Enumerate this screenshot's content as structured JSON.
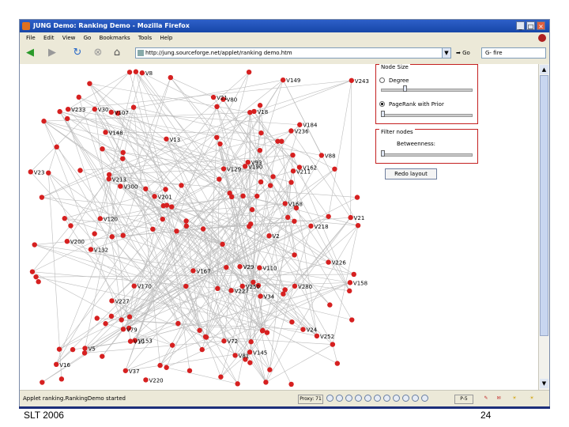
{
  "window": {
    "title": "JUNG Demo: Ranking Demo - Mozilla Firefox",
    "buttons": {
      "minimize": "_",
      "maximize": "□",
      "close": "×"
    }
  },
  "menu": [
    "File",
    "Edit",
    "View",
    "Go",
    "Bookmarks",
    "Tools",
    "Help"
  ],
  "toolbar": {
    "url": "http://jung.sourceforge.net/applet/ranking demo.htm",
    "go_label": "Go",
    "search_value": "G- fire"
  },
  "panel": {
    "node_size_legend": "Node Size",
    "option_degree": "Degree",
    "option_pagerank": "PageRank with Prior",
    "filter_legend": "Filter nodes",
    "betweenness_label": "Betweenness:",
    "relayout_label": "Redo layout"
  },
  "status": {
    "text": "Applet ranking.RankingDemo started",
    "mode": "Proxy: 71",
    "zoom": "P-5"
  },
  "footer": {
    "left": "SLT 2006",
    "right": "24"
  },
  "graph": {
    "node_color": "#d62020",
    "edge_color": "#bdbdbd",
    "labels": [
      "V190",
      "V5",
      "V236",
      "V252",
      "V300",
      "V184",
      "V21",
      "V162",
      "V80",
      "V201",
      "V107",
      "V13",
      "V227",
      "V93",
      "V226",
      "V280",
      "V132",
      "V16",
      "V10",
      "V23",
      "V72",
      "V250",
      "V18",
      "V170",
      "V200",
      "V211",
      "V8",
      "V233",
      "V120",
      "V220",
      "V227",
      "V2",
      "V149",
      "V110",
      "V129",
      "V88",
      "V243",
      "V37",
      "V145",
      "V21",
      "V79",
      "V30",
      "V153",
      "V24",
      "V213",
      "V81",
      "V167",
      "V29",
      "V168",
      "V148",
      "V158",
      "V34",
      "V218"
    ]
  }
}
